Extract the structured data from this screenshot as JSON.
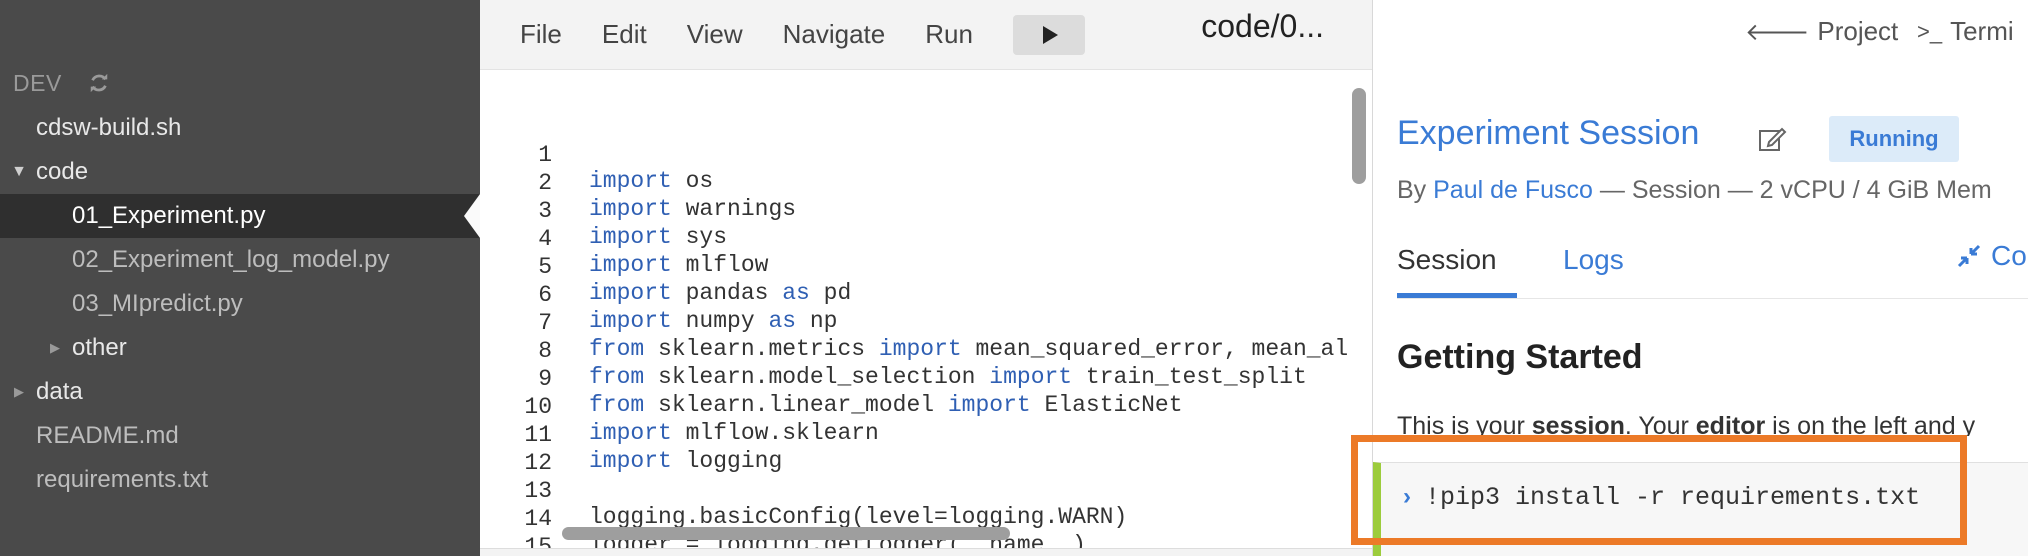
{
  "sidebar": {
    "project_name": "DEV",
    "items": [
      {
        "label": "cdsw-build.sh",
        "caret": ""
      },
      {
        "label": "code",
        "caret": "▼"
      },
      {
        "label": "01_Experiment.py",
        "caret": ""
      },
      {
        "label": "02_Experiment_log_model.py",
        "caret": ""
      },
      {
        "label": "03_MIpredict.py",
        "caret": ""
      },
      {
        "label": "other",
        "caret": "▶"
      },
      {
        "label": "data",
        "caret": "▶"
      },
      {
        "label": "README.md",
        "caret": ""
      },
      {
        "label": "requirements.txt",
        "caret": ""
      }
    ]
  },
  "editor": {
    "menu": {
      "file": "File",
      "edit": "Edit",
      "view": "View",
      "navigate": "Navigate",
      "run": "Run"
    },
    "file_title": "code/0...",
    "lines": [
      {
        "n": "1",
        "kw": "import",
        "rest": " os"
      },
      {
        "n": "2",
        "kw": "import",
        "rest": " warnings"
      },
      {
        "n": "3",
        "kw": "import",
        "rest": " sys"
      },
      {
        "n": "4",
        "kw": "import",
        "rest": " mlflow"
      },
      {
        "n": "5",
        "kw": "import",
        "rest": " pandas ",
        "kw2": "as",
        "rest2": " pd"
      },
      {
        "n": "6",
        "kw": "import",
        "rest": " numpy ",
        "kw2": "as",
        "rest2": " np"
      },
      {
        "n": "7",
        "kw": "from",
        "rest": " sklearn.metrics ",
        "kw2": "import",
        "rest2": " mean_squared_error, mean_al"
      },
      {
        "n": "8",
        "kw": "from",
        "rest": " sklearn.model_selection ",
        "kw2": "import",
        "rest2": " train_test_split"
      },
      {
        "n": "9",
        "kw": "from",
        "rest": " sklearn.linear_model ",
        "kw2": "import",
        "rest2": " ElasticNet"
      },
      {
        "n": "10",
        "kw": "import",
        "rest": " mlflow.sklearn"
      },
      {
        "n": "11",
        "kw": "import",
        "rest": " logging"
      },
      {
        "n": "12",
        "kw": "",
        "rest": ""
      },
      {
        "n": "13",
        "kw": "",
        "rest": "logging.basicConfig(level=logging.WARN)"
      },
      {
        "n": "14",
        "kw": "",
        "rest": "logger = logging.getLogger(__name__)"
      },
      {
        "n": "15",
        "kw": "",
        "rest": ""
      }
    ]
  },
  "session": {
    "nav": {
      "project": "Project",
      "terminal": "Termi"
    },
    "title": "Experiment Session",
    "status": "Running",
    "byline_prefix": "By ",
    "author": "Paul de Fusco",
    "byline_suffix": " — Session — 2 vCPU / 4 GiB Mem",
    "tabs": {
      "session": "Session",
      "logs": "Logs",
      "collapse": "Co"
    },
    "heading": "Getting Started",
    "intro": {
      "a": "This is your ",
      "b": "session",
      "c": ". Your ",
      "d": "editor",
      "e": " is on the left and y"
    },
    "prompt": "›",
    "command": "!pip3 install -r requirements.txt"
  },
  "colors": {
    "accent": "#3a7bd5",
    "highlight": "#ec7a28",
    "input_bar": "#9ccc3c",
    "sidebar_bg": "#4a4a4a"
  }
}
